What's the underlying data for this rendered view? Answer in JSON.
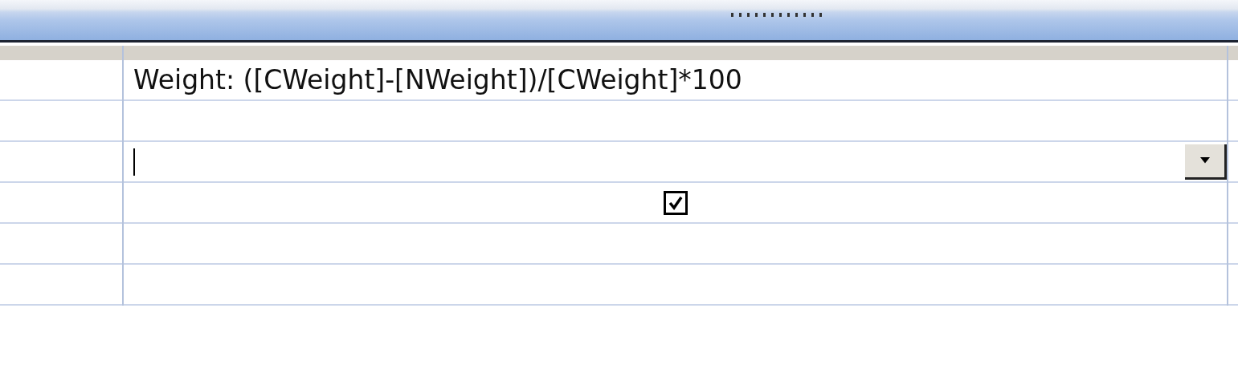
{
  "grid": {
    "rows": [
      {
        "kind": "text",
        "value": "Weight: ([CWeight]-[NWeight])/[CWeight]*100"
      },
      {
        "kind": "empty"
      },
      {
        "kind": "combo",
        "focused": true
      },
      {
        "kind": "checkbox",
        "checked": true
      },
      {
        "kind": "empty"
      },
      {
        "kind": "empty"
      }
    ]
  }
}
